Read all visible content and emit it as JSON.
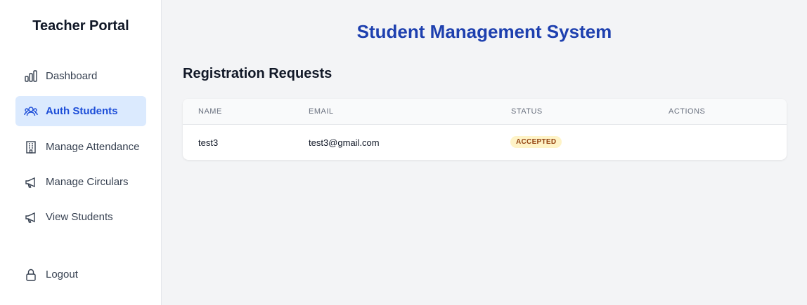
{
  "sidebar": {
    "brand": "Teacher Portal",
    "items": [
      {
        "label": "Dashboard",
        "icon": "bar-chart-icon"
      },
      {
        "label": "Auth Students",
        "icon": "users-icon",
        "active": true
      },
      {
        "label": "Manage Attendance",
        "icon": "building-icon"
      },
      {
        "label": "Manage Circulars",
        "icon": "megaphone-icon"
      },
      {
        "label": "View Students",
        "icon": "megaphone-icon"
      }
    ],
    "logout": {
      "label": "Logout",
      "icon": "lock-icon"
    }
  },
  "main": {
    "title": "Student Management System",
    "section_title": "Registration Requests",
    "table": {
      "headers": {
        "name": "NAME",
        "email": "EMAIL",
        "status": "STATUS",
        "actions": "ACTIONS"
      },
      "rows": [
        {
          "name": "test3",
          "email": "test3@gmail.com",
          "status": "ACCEPTED"
        }
      ]
    }
  },
  "colors": {
    "accent": "#1e40af",
    "active_bg": "#dbeafe",
    "badge_bg": "#fef3c7",
    "badge_text": "#92400e"
  }
}
